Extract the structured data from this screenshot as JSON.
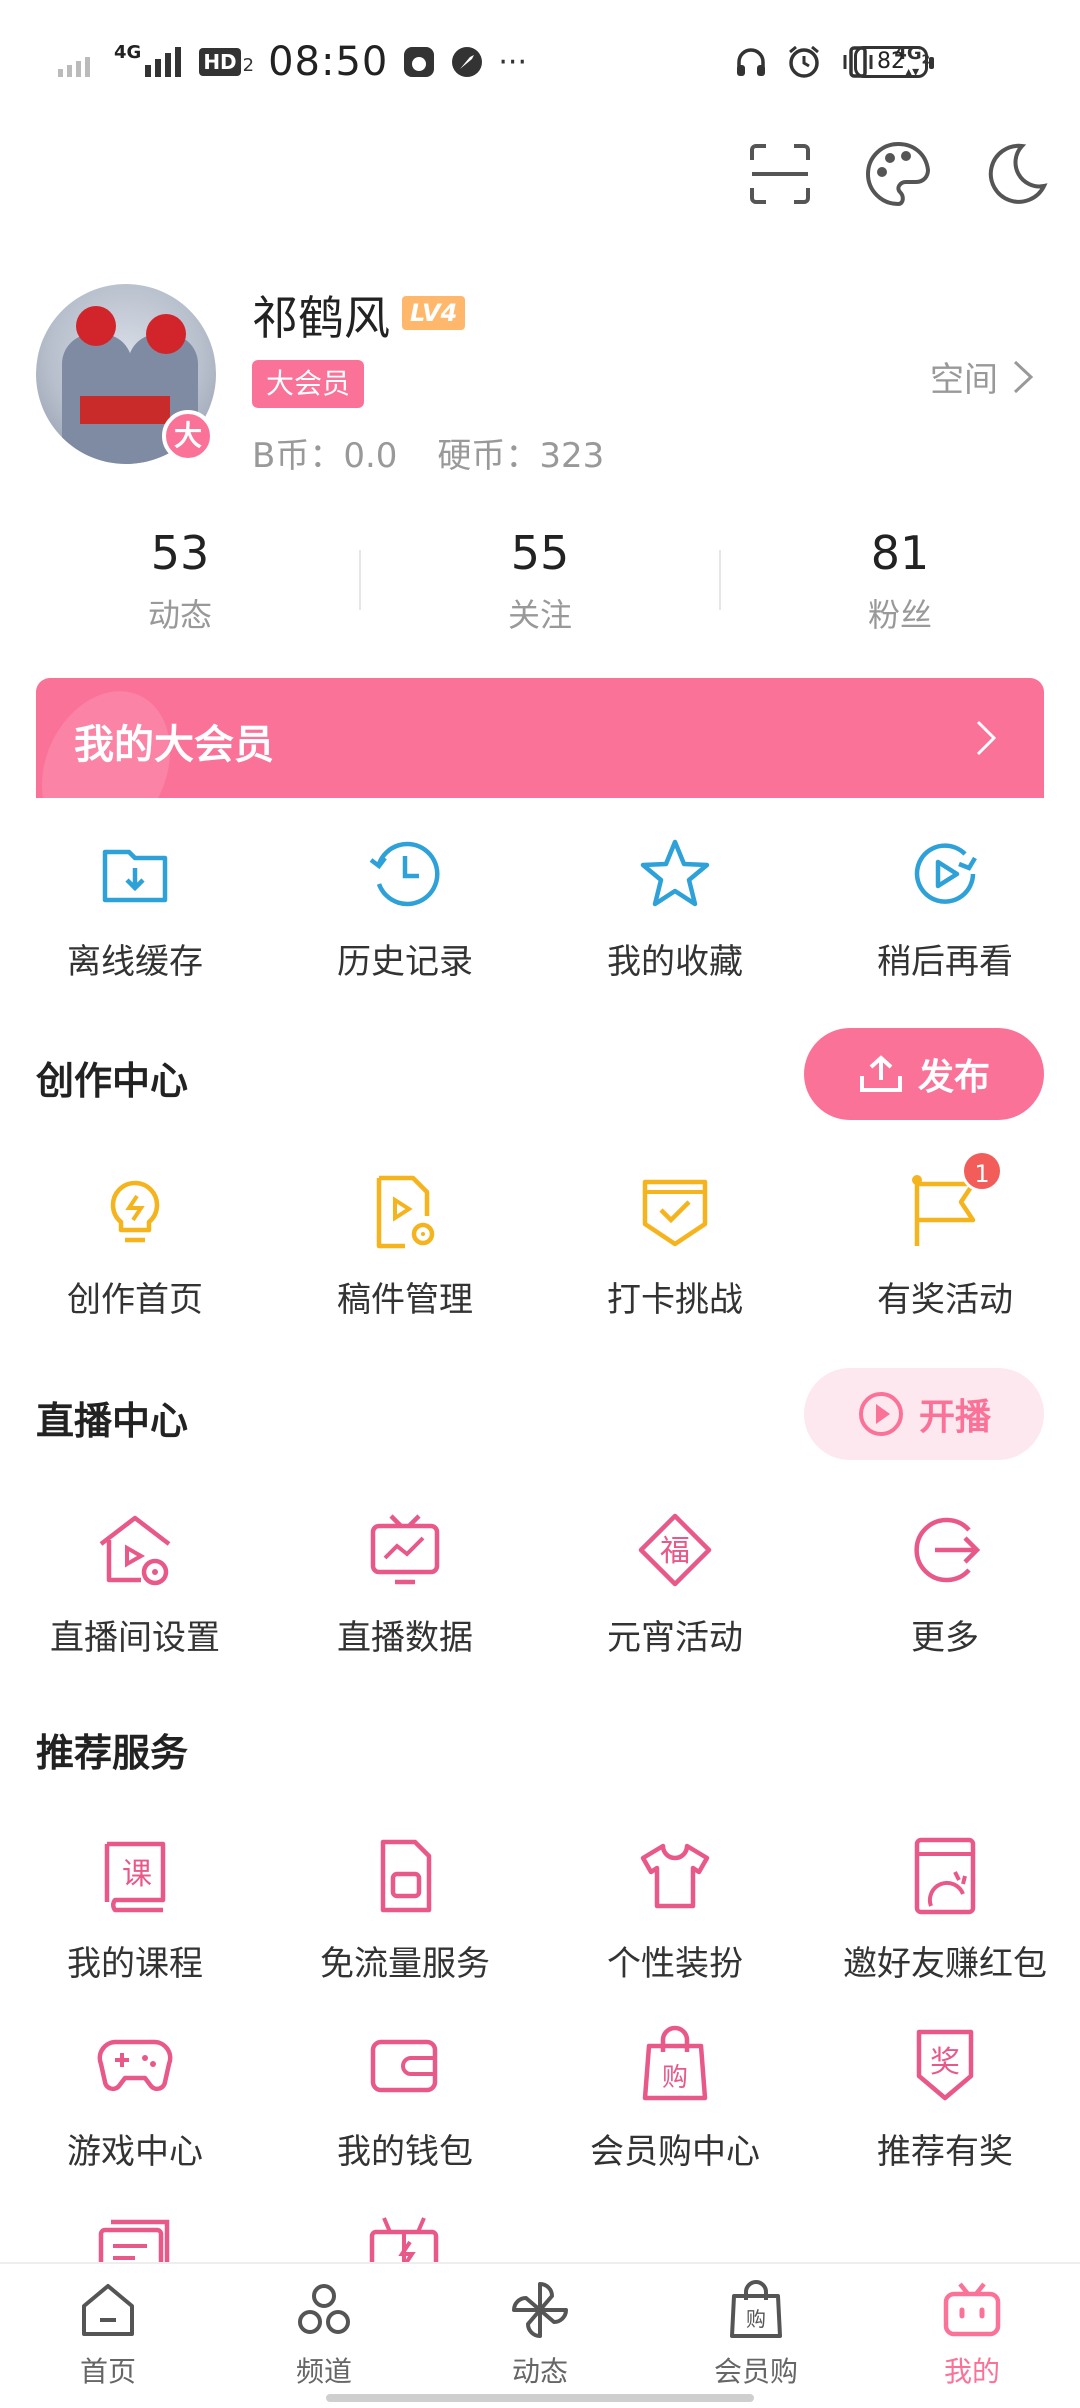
{
  "status_bar": {
    "network": "4G",
    "hd": "HD",
    "hd_sub": "2",
    "time": "08:50",
    "more": "···",
    "net2": "4G",
    "net2_sub": "2",
    "battery": "82"
  },
  "toolbar": {
    "icons": [
      "scan-icon",
      "palette-icon",
      "night-mode-icon"
    ]
  },
  "profile": {
    "username": "祁鹤风",
    "level": "LV4",
    "vip_tag": "大会员",
    "avatar_badge": "大",
    "b_coin_label": "B币：0.0",
    "coin_label": "硬币：323",
    "space_link": "空间"
  },
  "stats": [
    {
      "value": "53",
      "label": "动态"
    },
    {
      "value": "55",
      "label": "关注"
    },
    {
      "value": "81",
      "label": "粉丝"
    }
  ],
  "vip_banner": {
    "text": "我的大会员"
  },
  "quick_actions": [
    {
      "label": "离线缓存",
      "icon": "download-folder-icon"
    },
    {
      "label": "历史记录",
      "icon": "history-clock-icon"
    },
    {
      "label": "我的收藏",
      "icon": "star-icon"
    },
    {
      "label": "稍后再看",
      "icon": "watch-later-icon"
    }
  ],
  "creation": {
    "title": "创作中心",
    "publish_label": "发布",
    "items": [
      {
        "label": "创作首页",
        "icon": "lightbulb-icon"
      },
      {
        "label": "稿件管理",
        "icon": "manuscript-icon"
      },
      {
        "label": "打卡挑战",
        "icon": "checkin-icon"
      },
      {
        "label": "有奖活动",
        "icon": "flag-icon",
        "badge": "1"
      }
    ]
  },
  "live": {
    "title": "直播中心",
    "start_label": "开播",
    "items": [
      {
        "label": "直播间设置",
        "icon": "live-room-settings-icon"
      },
      {
        "label": "直播数据",
        "icon": "live-data-icon"
      },
      {
        "label": "元宵活动",
        "icon": "fu-icon"
      },
      {
        "label": "更多",
        "icon": "more-arrow-icon"
      }
    ]
  },
  "services": {
    "title": "推荐服务",
    "items": [
      {
        "label": "我的课程",
        "icon": "course-icon"
      },
      {
        "label": "免流量服务",
        "icon": "sim-card-icon"
      },
      {
        "label": "个性装扮",
        "icon": "tshirt-icon"
      },
      {
        "label": "邀好友赚红包",
        "icon": "invite-icon"
      },
      {
        "label": "游戏中心",
        "icon": "gamepad-icon"
      },
      {
        "label": "我的钱包",
        "icon": "wallet-icon"
      },
      {
        "label": "会员购中心",
        "icon": "shopping-bag-icon"
      },
      {
        "label": "推荐有奖",
        "icon": "reward-icon"
      }
    ]
  },
  "bottom_nav": [
    {
      "label": "首页",
      "icon": "home-icon",
      "active": false
    },
    {
      "label": "频道",
      "icon": "channel-icon",
      "active": false
    },
    {
      "label": "动态",
      "icon": "windmill-icon",
      "active": false
    },
    {
      "label": "会员购",
      "icon": "shopping-bag-icon",
      "active": false
    },
    {
      "label": "我的",
      "icon": "tv-icon",
      "active": true
    }
  ],
  "colors": {
    "accent": "#fb7299",
    "blue_icon": "#2fa1d9",
    "yellow_icon": "#f5b41e",
    "badge_red": "#f25d59"
  }
}
